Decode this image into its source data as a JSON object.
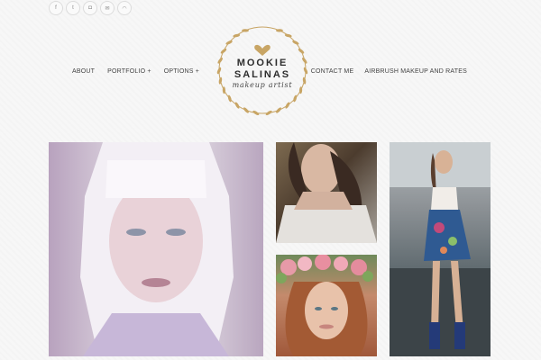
{
  "social": [
    {
      "glyph": "f",
      "icon": "facebook-icon"
    },
    {
      "glyph": "t",
      "icon": "twitter-icon"
    },
    {
      "glyph": "◘",
      "icon": "instagram-icon"
    },
    {
      "glyph": "✉",
      "icon": "email-icon"
    },
    {
      "glyph": "◠",
      "icon": "rss-icon"
    }
  ],
  "nav": {
    "left": [
      {
        "label": "ABOUT"
      },
      {
        "label": "PORTFOLIO +"
      },
      {
        "label": "OPTIONS +"
      }
    ],
    "right": [
      {
        "label": "CONTACT ME"
      },
      {
        "label": "AIRBRUSH MAKEUP AND RATES"
      }
    ]
  },
  "logo": {
    "line1": "MOOKIE",
    "line2": "SALINAS",
    "subtitle": "makeup artist",
    "heart_color": "#c8a565",
    "wreath_color": "#c8a565"
  },
  "gallery": [
    {
      "name": "photo-white-bob-portrait"
    },
    {
      "name": "photo-strapless-gown"
    },
    {
      "name": "photo-flower-crown"
    },
    {
      "name": "photo-floral-dress-boots"
    }
  ]
}
